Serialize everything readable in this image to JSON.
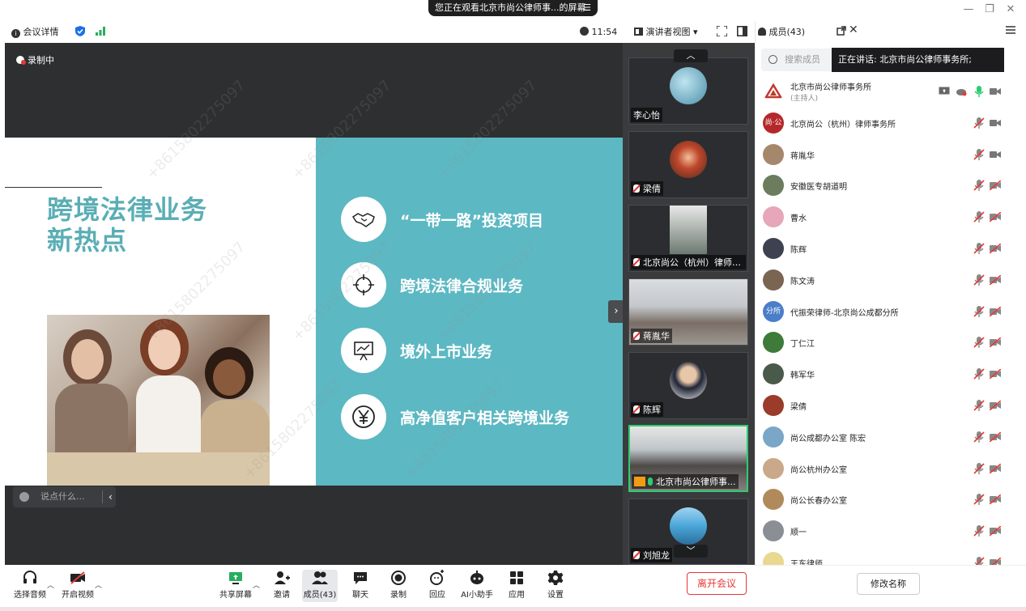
{
  "window": {
    "viewing_banner": "您正在观看北京市尚公律师事...的屏幕",
    "banner_menu": "☰",
    "minimize": "—",
    "restore": "❐",
    "close": "✕"
  },
  "infobar": {
    "meeting_details": "会议详情",
    "time": "11:54",
    "view_mode": "演讲者视图",
    "members_label": "成员(43)"
  },
  "stage": {
    "recording": "录制中",
    "slide_title_line1": "跨境法律业务",
    "slide_title_line2": "新热点",
    "items": [
      {
        "label": "“一带一路”投资项目",
        "icon": "handshake-icon"
      },
      {
        "label": "跨境法律合规业务",
        "icon": "crosshair-icon"
      },
      {
        "label": "境外上市业务",
        "icon": "presentation-icon"
      },
      {
        "label": "高净值客户相关跨境业务",
        "icon": "yen-icon"
      }
    ],
    "chat_placeholder": "说点什么...",
    "watermark": "+8615802275097"
  },
  "tiles": [
    {
      "name": "李心怡",
      "muted": false
    },
    {
      "name": "梁倩",
      "muted": true
    },
    {
      "name": "北京尚公（杭州）律师事...",
      "muted": true
    },
    {
      "name": "蒋胤华",
      "muted": true
    },
    {
      "name": "陈辉",
      "muted": true
    },
    {
      "name": "北京市尚公律师事...",
      "muted": false
    },
    {
      "name": "刘旭龙",
      "muted": true
    }
  ],
  "toolbar": {
    "audio": "选择音频",
    "video": "开启视频",
    "share": "共享屏幕",
    "invite": "邀请",
    "members": "成员(43)",
    "chat": "聊天",
    "record": "录制",
    "replay": "回应",
    "ai": "AI小助手",
    "apps": "应用",
    "settings": "设置",
    "leave": "离开会议"
  },
  "panel": {
    "title": "成员(43)",
    "search_placeholder": "搜索成员",
    "speaking": "正在讲话:  北京市尚公律师事务所;",
    "rename": "修改名称",
    "members": [
      {
        "name": "北京市尚公律师事务所",
        "sub": "(主持人)",
        "avatar": "logo",
        "color": "#ffffff"
      },
      {
        "name": "北京尚公（杭州）律师事务所",
        "sub": "",
        "avatar": "尚·公",
        "color": "#b5282a"
      },
      {
        "name": "蒋胤华",
        "sub": "",
        "avatar": "",
        "color": "#a5886b"
      },
      {
        "name": "安徽医专胡道明",
        "sub": "",
        "avatar": "",
        "color": "#6b7d5e"
      },
      {
        "name": "曹水",
        "sub": "",
        "avatar": "",
        "color": "#e5a7b9"
      },
      {
        "name": "陈辉",
        "sub": "",
        "avatar": "",
        "color": "#3d4150"
      },
      {
        "name": "陈文涛",
        "sub": "",
        "avatar": "",
        "color": "#7a6552"
      },
      {
        "name": "代振荣律师-北京尚公成都分所",
        "sub": "",
        "avatar": "分所",
        "color": "#4b7ec9"
      },
      {
        "name": "丁仁江",
        "sub": "",
        "avatar": "",
        "color": "#3e7a3a"
      },
      {
        "name": "韩军华",
        "sub": "",
        "avatar": "",
        "color": "#4a5a4a"
      },
      {
        "name": "梁倩",
        "sub": "",
        "avatar": "",
        "color": "#9b3b2a"
      },
      {
        "name": "尚公成都办公室 陈宏",
        "sub": "",
        "avatar": "",
        "color": "#7aa7c7"
      },
      {
        "name": "尚公杭州办公室",
        "sub": "",
        "avatar": "",
        "color": "#c9a98a"
      },
      {
        "name": "尚公长春办公室",
        "sub": "",
        "avatar": "",
        "color": "#b08a5a"
      },
      {
        "name": "顺一",
        "sub": "",
        "avatar": "",
        "color": "#8a8f96"
      },
      {
        "name": "王东律师",
        "sub": "",
        "avatar": "",
        "color": "#e8d890"
      }
    ]
  }
}
